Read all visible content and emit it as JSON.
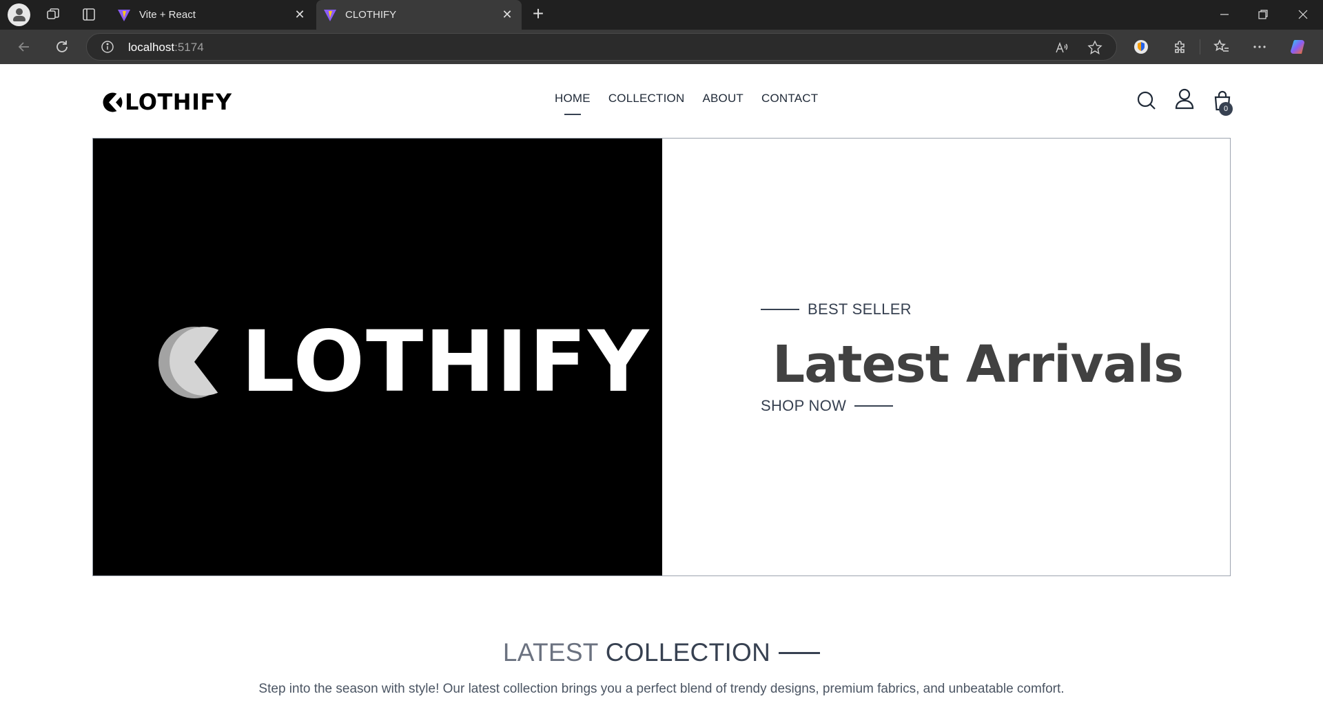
{
  "browser": {
    "tabs": [
      {
        "title": "Vite + React",
        "active": false
      },
      {
        "title": "CLOTHIFY",
        "active": true
      }
    ],
    "address": {
      "host": "localhost",
      "port": ":5174"
    },
    "icons": [
      "profile-icon",
      "workspaces-icon",
      "tab-actions-icon",
      "back-icon",
      "refresh-icon",
      "info-icon",
      "read-aloud-icon",
      "favorite-star-icon",
      "shield-extension-icon",
      "extensions-icon",
      "favorites-icon",
      "more-icon",
      "copilot-icon",
      "minimize-icon",
      "restore-icon",
      "close-icon"
    ]
  },
  "site": {
    "logo_text": "LOTHIFY",
    "nav": [
      "HOME",
      "COLLECTION",
      "ABOUT",
      "CONTACT"
    ],
    "active_nav": "HOME",
    "cart_count": "0",
    "icons": [
      "search-icon",
      "profile-icon",
      "cart-icon"
    ]
  },
  "hero": {
    "image_logo_text": "LOTHIFY",
    "eyebrow": "BEST SELLER",
    "title": "Latest Arrivals",
    "cta": "SHOP NOW"
  },
  "latest": {
    "title_light": "LATEST",
    "title_bold": "COLLECTION",
    "description": "Step into the season with style! Our latest collection brings you a perfect blend of trendy designs, premium fabrics, and unbeatable comfort."
  },
  "colors": {
    "chrome_dark": "#202020",
    "chrome_mid": "#3a3a3a",
    "text_dark": "#374151",
    "hero_title": "#414141"
  }
}
